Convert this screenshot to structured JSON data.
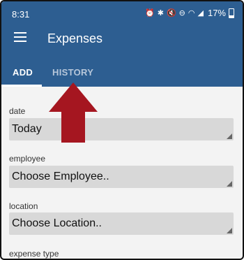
{
  "status_bar": {
    "time": "8:31",
    "battery": "17%"
  },
  "app": {
    "title": "Expenses"
  },
  "tabs": [
    {
      "label": "ADD",
      "selected": true
    },
    {
      "label": "HISTORY",
      "selected": false
    }
  ],
  "form": {
    "fields": [
      {
        "label": "date",
        "value": "Today"
      },
      {
        "label": "employee",
        "value": "Choose Employee.."
      },
      {
        "label": "location",
        "value": "Choose Location.."
      },
      {
        "label": "expense type"
      }
    ]
  },
  "colors": {
    "appbar": "#2d5e91",
    "arrow": "#a51620",
    "select_bg": "#d8d8d8"
  }
}
